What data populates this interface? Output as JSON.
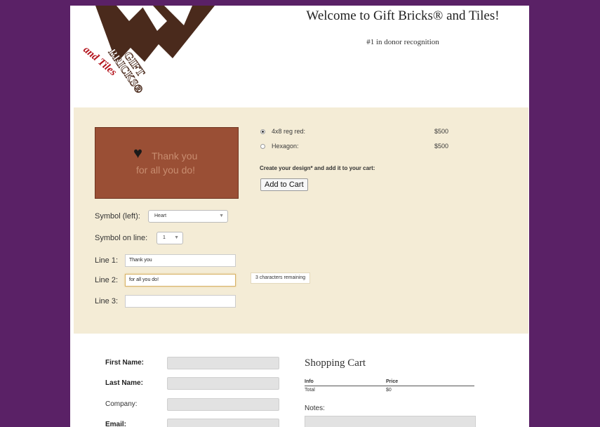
{
  "header": {
    "welcome": "Welcome to Gift Bricks® and Tiles!",
    "tagline": "#1 in donor recognition",
    "logo_text": [
      "GIFT",
      "BRICKS®",
      "and Tiles"
    ]
  },
  "designer": {
    "preview": {
      "line1": "Thank you",
      "line2": "for all you do!",
      "symbol_icon": "heart-icon"
    },
    "options": [
      {
        "label": "4x8 reg red:",
        "price": "$500",
        "selected": true
      },
      {
        "label": "Hexagon:",
        "price": "$500",
        "selected": false
      }
    ],
    "create_text": "Create your design* and add it to your cart:",
    "add_to_cart": "Add to Cart",
    "symbol_left_label": "Symbol (left):",
    "symbol_left_value": "Heart",
    "symbol_on_line_label": "Symbol on line:",
    "symbol_on_line_value": "1",
    "line1_label": "Line 1:",
    "line1_value": "Thank you",
    "line2_label": "Line 2:",
    "line2_value": "for all you do!",
    "line3_label": "Line 3:",
    "line3_value": "",
    "chars_remaining": "3 characters remaining"
  },
  "billing": {
    "first_name_label": "First Name:",
    "last_name_label": "Last Name:",
    "company_label": "Company:",
    "email_label": "Email:"
  },
  "cart": {
    "title": "Shopping Cart",
    "col_info": "Info",
    "col_price": "Price",
    "total_label": "Total",
    "total_value": "$0",
    "notes_label": "Notes:"
  },
  "colors": {
    "background": "#5a2166",
    "designer_panel": "#f4ecd6",
    "brick": "#9a4f35",
    "logo_brown": "#4a2a1c",
    "logo_red": "#b3121b"
  }
}
